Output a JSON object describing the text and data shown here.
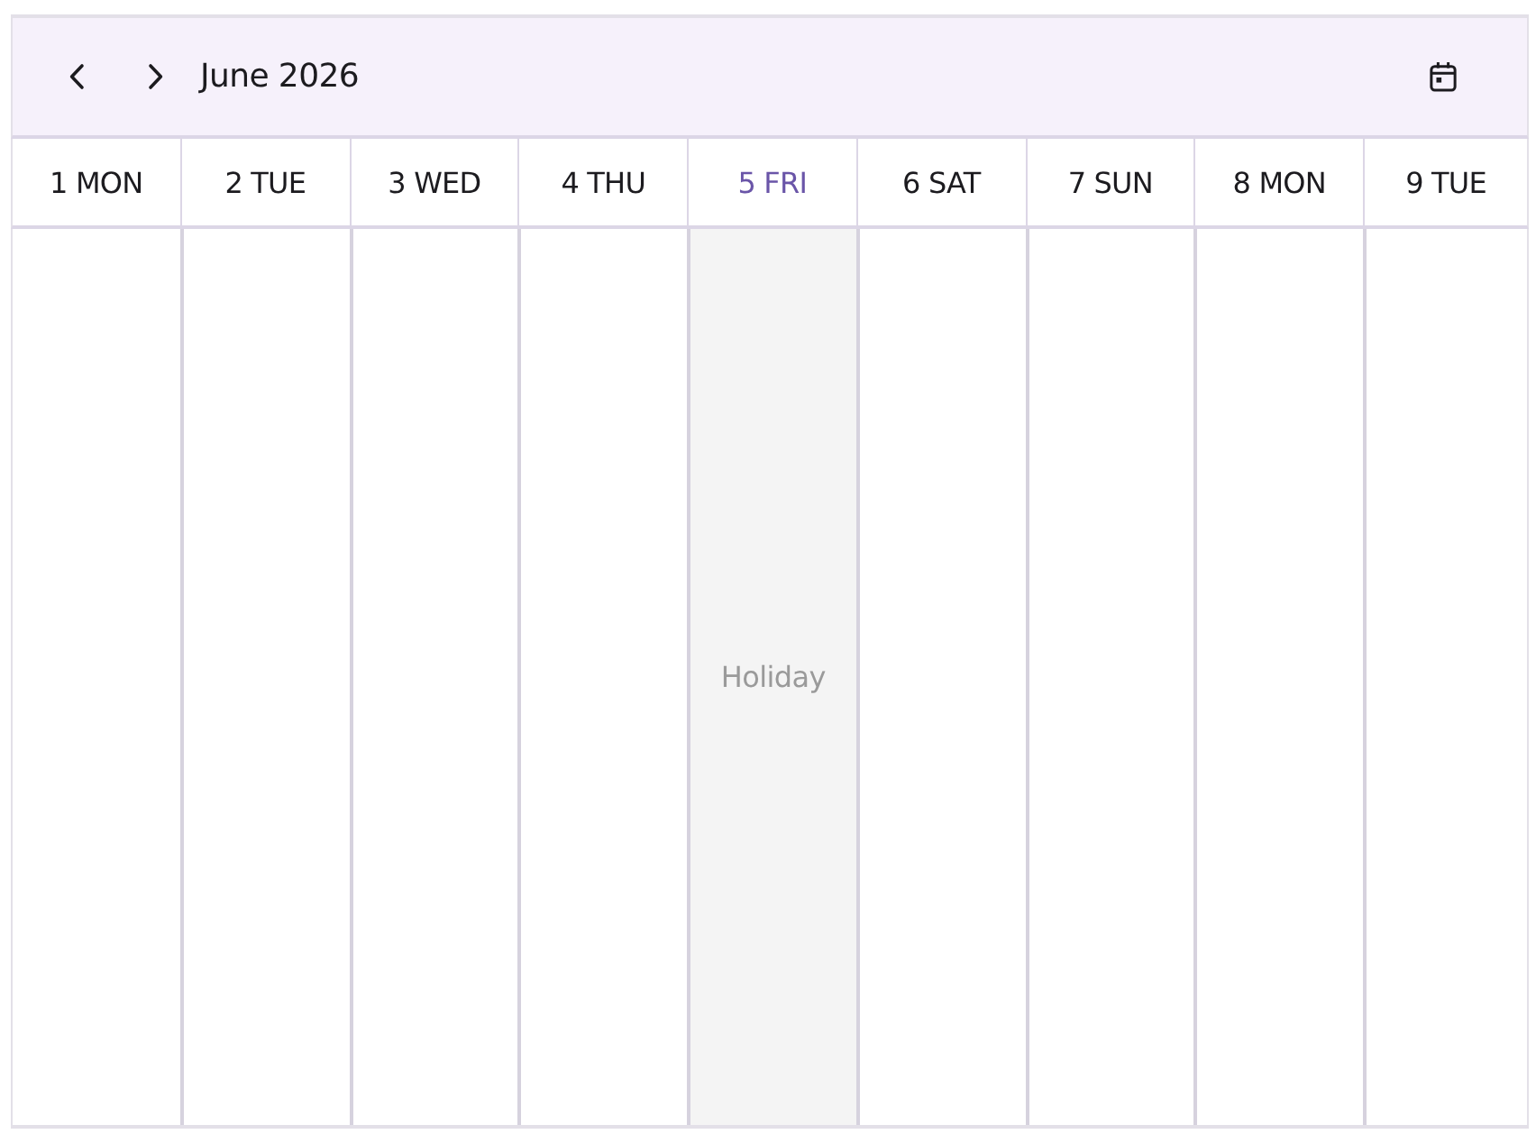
{
  "toolbar": {
    "title": "June 2026"
  },
  "days": [
    {
      "label": "1 MON",
      "selected": false
    },
    {
      "label": "2 TUE",
      "selected": false
    },
    {
      "label": "3 WED",
      "selected": false
    },
    {
      "label": "4 THU",
      "selected": false
    },
    {
      "label": "5 FRI",
      "selected": true,
      "region": "Holiday"
    },
    {
      "label": "6 SAT",
      "selected": false
    },
    {
      "label": "7 SUN",
      "selected": false
    },
    {
      "label": "8 MON",
      "selected": false
    },
    {
      "label": "9 TUE",
      "selected": false
    }
  ]
}
